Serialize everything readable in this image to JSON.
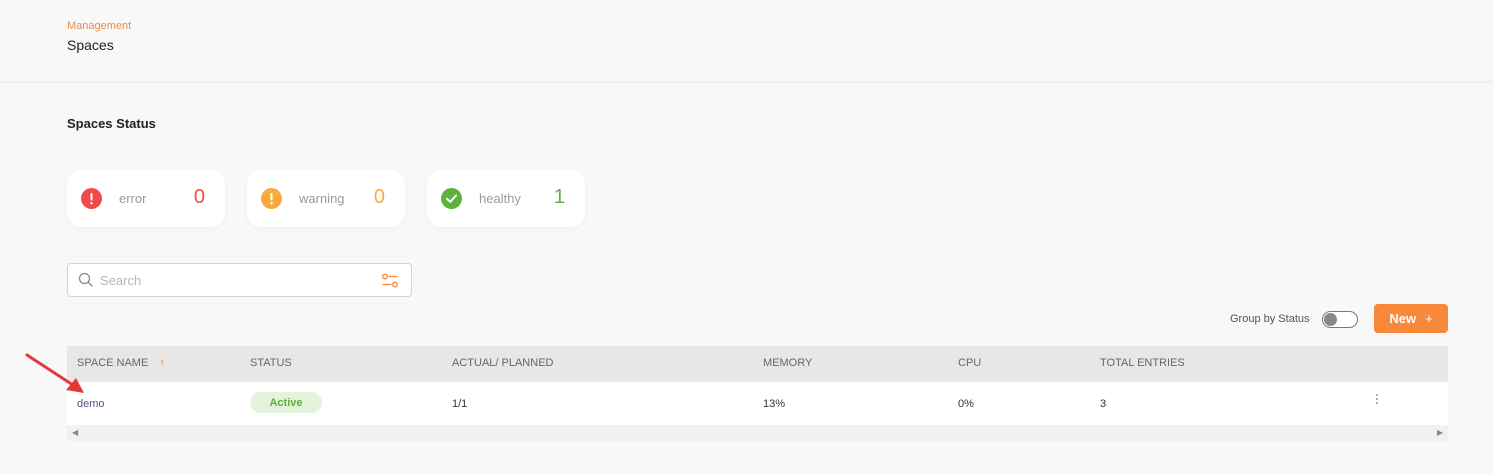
{
  "header": {
    "breadcrumb": "Management",
    "title": "Spaces"
  },
  "status_section": {
    "title": "Spaces Status",
    "cards": [
      {
        "label": "error",
        "count": "0",
        "color": "#f24a4a",
        "icon": "error-icon"
      },
      {
        "label": "warning",
        "count": "0",
        "color": "#f7ac3a",
        "icon": "warning-icon"
      },
      {
        "label": "healthy",
        "count": "1",
        "color": "#5cb33b",
        "icon": "check-icon"
      }
    ]
  },
  "search": {
    "placeholder": "Search",
    "value": ""
  },
  "toolbar": {
    "group_by_label": "Group by Status",
    "group_by_on": false,
    "new_label": "New",
    "new_plus": "+",
    "accent": "#f8893a"
  },
  "table": {
    "columns": [
      "SPACE NAME",
      "STATUS",
      "ACTUAL/ PLANNED",
      "MEMORY",
      "CPU",
      "TOTAL ENTRIES"
    ],
    "sort_indicator": "↑",
    "rows": [
      {
        "space_name": "demo",
        "status": "Active",
        "actual_planned": "1/1",
        "memory": "13%",
        "cpu": "0%",
        "total_entries": "3"
      }
    ]
  },
  "scrollbar": {
    "left": "◀",
    "right": "▶"
  }
}
